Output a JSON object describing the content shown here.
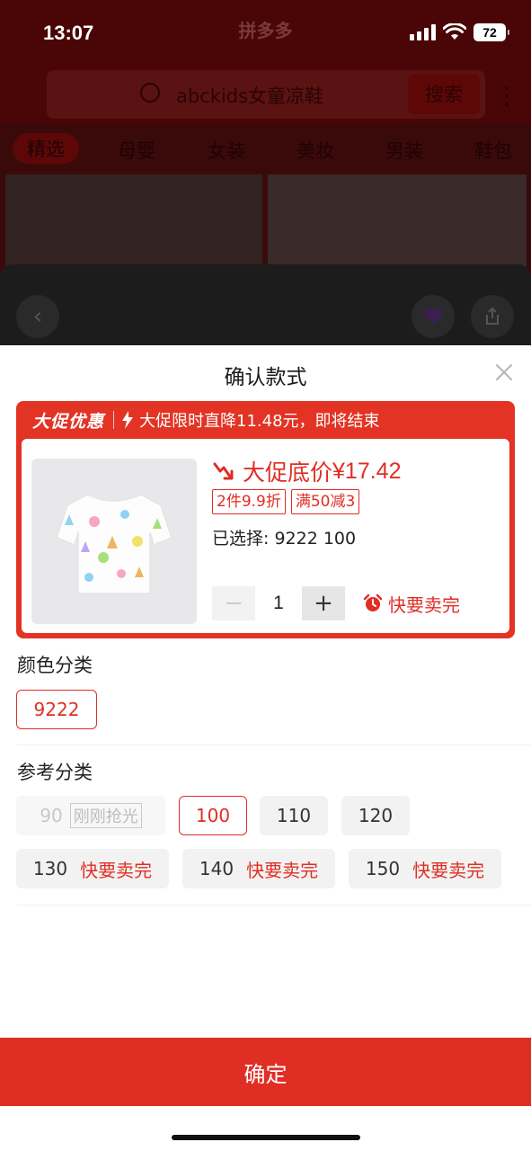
{
  "status_bar": {
    "time": "13:07",
    "battery": "72"
  },
  "background": {
    "logo": "拼多多",
    "search_text": "abckids女童凉鞋",
    "search_button": "搜索",
    "tabs": [
      "精选",
      "母婴",
      "女装",
      "美妆",
      "男装",
      "鞋包"
    ]
  },
  "sheet": {
    "title": "确认款式",
    "promo": {
      "brand": "大促优惠",
      "message": "大促限时直降11.48元，即将结束"
    },
    "product": {
      "price_label": "大促底价",
      "price": "¥17.42",
      "tags": [
        "2件9.9折",
        "满50减3"
      ],
      "selected": "已选择: 9222 100",
      "quantity": "1",
      "hurry": "快要卖完"
    },
    "color_section": {
      "label": "颜色分类",
      "options": [
        {
          "label": "9222"
        }
      ]
    },
    "size_section": {
      "label": "参考分类",
      "options": [
        {
          "label": "90",
          "tag": "刚刚抢光"
        },
        {
          "label": "100"
        },
        {
          "label": "110"
        },
        {
          "label": "120"
        },
        {
          "label": "130",
          "tag": "快要卖完"
        },
        {
          "label": "140",
          "tag": "快要卖完"
        },
        {
          "label": "150",
          "tag": "快要卖完"
        }
      ]
    },
    "confirm_button": "确定"
  },
  "colors": {
    "accent": "#e02e24",
    "promo_bg": "#e23324"
  }
}
